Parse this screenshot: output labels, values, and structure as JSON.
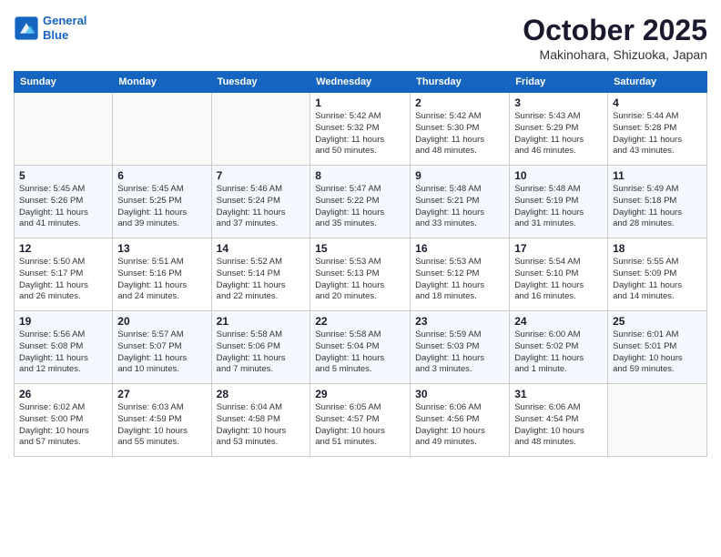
{
  "header": {
    "logo_line1": "General",
    "logo_line2": "Blue",
    "month": "October 2025",
    "location": "Makinohara, Shizuoka, Japan"
  },
  "weekdays": [
    "Sunday",
    "Monday",
    "Tuesday",
    "Wednesday",
    "Thursday",
    "Friday",
    "Saturday"
  ],
  "weeks": [
    [
      {
        "day": "",
        "info": ""
      },
      {
        "day": "",
        "info": ""
      },
      {
        "day": "",
        "info": ""
      },
      {
        "day": "1",
        "info": "Sunrise: 5:42 AM\nSunset: 5:32 PM\nDaylight: 11 hours\nand 50 minutes."
      },
      {
        "day": "2",
        "info": "Sunrise: 5:42 AM\nSunset: 5:30 PM\nDaylight: 11 hours\nand 48 minutes."
      },
      {
        "day": "3",
        "info": "Sunrise: 5:43 AM\nSunset: 5:29 PM\nDaylight: 11 hours\nand 46 minutes."
      },
      {
        "day": "4",
        "info": "Sunrise: 5:44 AM\nSunset: 5:28 PM\nDaylight: 11 hours\nand 43 minutes."
      }
    ],
    [
      {
        "day": "5",
        "info": "Sunrise: 5:45 AM\nSunset: 5:26 PM\nDaylight: 11 hours\nand 41 minutes."
      },
      {
        "day": "6",
        "info": "Sunrise: 5:45 AM\nSunset: 5:25 PM\nDaylight: 11 hours\nand 39 minutes."
      },
      {
        "day": "7",
        "info": "Sunrise: 5:46 AM\nSunset: 5:24 PM\nDaylight: 11 hours\nand 37 minutes."
      },
      {
        "day": "8",
        "info": "Sunrise: 5:47 AM\nSunset: 5:22 PM\nDaylight: 11 hours\nand 35 minutes."
      },
      {
        "day": "9",
        "info": "Sunrise: 5:48 AM\nSunset: 5:21 PM\nDaylight: 11 hours\nand 33 minutes."
      },
      {
        "day": "10",
        "info": "Sunrise: 5:48 AM\nSunset: 5:19 PM\nDaylight: 11 hours\nand 31 minutes."
      },
      {
        "day": "11",
        "info": "Sunrise: 5:49 AM\nSunset: 5:18 PM\nDaylight: 11 hours\nand 28 minutes."
      }
    ],
    [
      {
        "day": "12",
        "info": "Sunrise: 5:50 AM\nSunset: 5:17 PM\nDaylight: 11 hours\nand 26 minutes."
      },
      {
        "day": "13",
        "info": "Sunrise: 5:51 AM\nSunset: 5:16 PM\nDaylight: 11 hours\nand 24 minutes."
      },
      {
        "day": "14",
        "info": "Sunrise: 5:52 AM\nSunset: 5:14 PM\nDaylight: 11 hours\nand 22 minutes."
      },
      {
        "day": "15",
        "info": "Sunrise: 5:53 AM\nSunset: 5:13 PM\nDaylight: 11 hours\nand 20 minutes."
      },
      {
        "day": "16",
        "info": "Sunrise: 5:53 AM\nSunset: 5:12 PM\nDaylight: 11 hours\nand 18 minutes."
      },
      {
        "day": "17",
        "info": "Sunrise: 5:54 AM\nSunset: 5:10 PM\nDaylight: 11 hours\nand 16 minutes."
      },
      {
        "day": "18",
        "info": "Sunrise: 5:55 AM\nSunset: 5:09 PM\nDaylight: 11 hours\nand 14 minutes."
      }
    ],
    [
      {
        "day": "19",
        "info": "Sunrise: 5:56 AM\nSunset: 5:08 PM\nDaylight: 11 hours\nand 12 minutes."
      },
      {
        "day": "20",
        "info": "Sunrise: 5:57 AM\nSunset: 5:07 PM\nDaylight: 11 hours\nand 10 minutes."
      },
      {
        "day": "21",
        "info": "Sunrise: 5:58 AM\nSunset: 5:06 PM\nDaylight: 11 hours\nand 7 minutes."
      },
      {
        "day": "22",
        "info": "Sunrise: 5:58 AM\nSunset: 5:04 PM\nDaylight: 11 hours\nand 5 minutes."
      },
      {
        "day": "23",
        "info": "Sunrise: 5:59 AM\nSunset: 5:03 PM\nDaylight: 11 hours\nand 3 minutes."
      },
      {
        "day": "24",
        "info": "Sunrise: 6:00 AM\nSunset: 5:02 PM\nDaylight: 11 hours\nand 1 minute."
      },
      {
        "day": "25",
        "info": "Sunrise: 6:01 AM\nSunset: 5:01 PM\nDaylight: 10 hours\nand 59 minutes."
      }
    ],
    [
      {
        "day": "26",
        "info": "Sunrise: 6:02 AM\nSunset: 5:00 PM\nDaylight: 10 hours\nand 57 minutes."
      },
      {
        "day": "27",
        "info": "Sunrise: 6:03 AM\nSunset: 4:59 PM\nDaylight: 10 hours\nand 55 minutes."
      },
      {
        "day": "28",
        "info": "Sunrise: 6:04 AM\nSunset: 4:58 PM\nDaylight: 10 hours\nand 53 minutes."
      },
      {
        "day": "29",
        "info": "Sunrise: 6:05 AM\nSunset: 4:57 PM\nDaylight: 10 hours\nand 51 minutes."
      },
      {
        "day": "30",
        "info": "Sunrise: 6:06 AM\nSunset: 4:56 PM\nDaylight: 10 hours\nand 49 minutes."
      },
      {
        "day": "31",
        "info": "Sunrise: 6:06 AM\nSunset: 4:54 PM\nDaylight: 10 hours\nand 48 minutes."
      },
      {
        "day": "",
        "info": ""
      }
    ]
  ]
}
